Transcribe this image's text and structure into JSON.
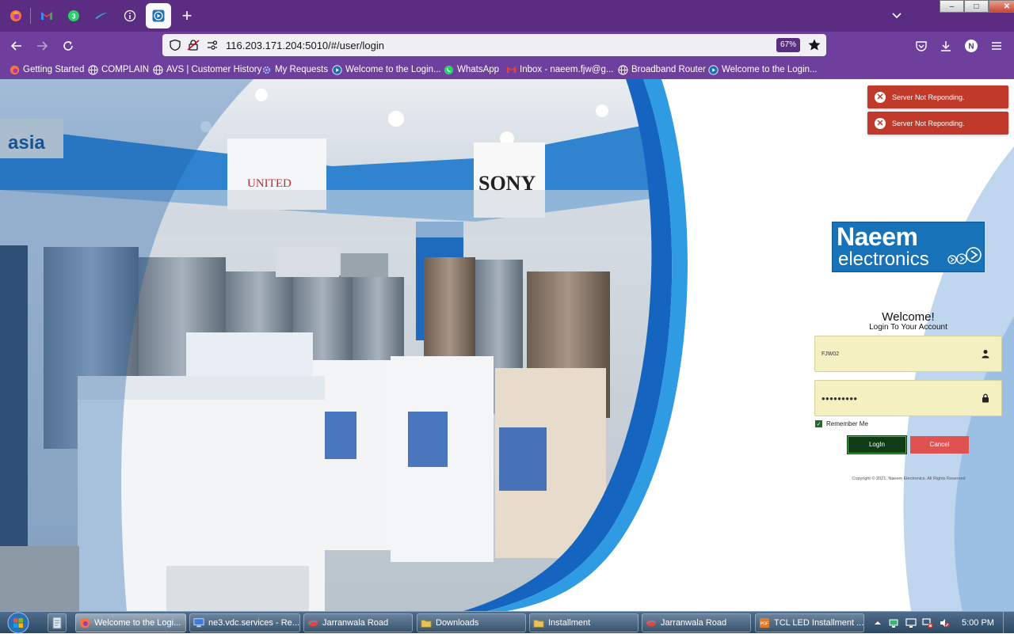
{
  "browser": {
    "tabs": [
      {
        "name": "Firefox View",
        "icon": "firefox-icon"
      },
      {
        "name": "Gmail",
        "icon": "gmail-icon"
      },
      {
        "name": "WhatsApp",
        "icon": "whatsapp-icon"
      },
      {
        "name": "Swift",
        "icon": "swoosh-icon"
      },
      {
        "name": "Info",
        "icon": "info-icon"
      },
      {
        "name": "Welcome to the Login",
        "icon": "play-icon",
        "active": true
      }
    ],
    "url": "116.203.171.204:5010/#/user/login",
    "zoom": "67%",
    "profile_initial": "N",
    "bookmarks": [
      {
        "label": "Getting Started",
        "icon": "firefox-icon"
      },
      {
        "label": "COMPLAIN",
        "icon": "globe-icon"
      },
      {
        "label": "AVS | Customer History",
        "icon": "globe-icon"
      },
      {
        "label": "My Requests",
        "icon": "gear-icon"
      },
      {
        "label": "Welcome to the Login...",
        "icon": "play-icon"
      },
      {
        "label": "WhatsApp",
        "icon": "whatsapp-icon"
      },
      {
        "label": "Inbox - naeem.fjw@g...",
        "icon": "gmail-icon"
      },
      {
        "label": "Broadband Router",
        "icon": "globe-icon"
      },
      {
        "label": "Welcome to the Login...",
        "icon": "play-icon"
      }
    ]
  },
  "toasts": [
    {
      "message": "Server Not Reponding."
    },
    {
      "message": "Server Not Reponding."
    }
  ],
  "store_signs": {
    "asia": "asia",
    "united": "UNITED",
    "sony": "SONY"
  },
  "logo": {
    "line1": "Naeem",
    "line2": "electronics"
  },
  "login": {
    "welcome": "Welcome!",
    "subtitle": "Login To Your Account",
    "username_value": "FJW02",
    "password_value": "•••••••••",
    "remember_label": "Remember Me",
    "login_label": "LogIn",
    "cancel_label": "Cancel",
    "copyright": "Copyright © 2021, Naeem Electronics. All Rights Reserved"
  },
  "taskbar": {
    "items": [
      {
        "label": "Welcome to the Logi...",
        "icon": "firefox-icon",
        "active": true
      },
      {
        "label": "ne3.vdc.services - Re...",
        "icon": "remote-desktop-icon"
      },
      {
        "label": "Jarranwala Road",
        "icon": "app-icon"
      },
      {
        "label": "Downloads",
        "icon": "folder-icon"
      },
      {
        "label": "Installment",
        "icon": "folder-icon"
      },
      {
        "label": "Jarranwala Road",
        "icon": "app-icon"
      },
      {
        "label": "TCL LED Installment ...",
        "icon": "pdf-icon"
      }
    ],
    "clock": "5:00 PM"
  },
  "colors": {
    "tabstrip": "#5a2d82",
    "navbar": "#6e3f9c",
    "toast": "#c0392b",
    "field": "#f5f0c2",
    "login_btn": "#0f3b16",
    "cancel_btn": "#e05252",
    "logo_bg": "#1872b8"
  }
}
